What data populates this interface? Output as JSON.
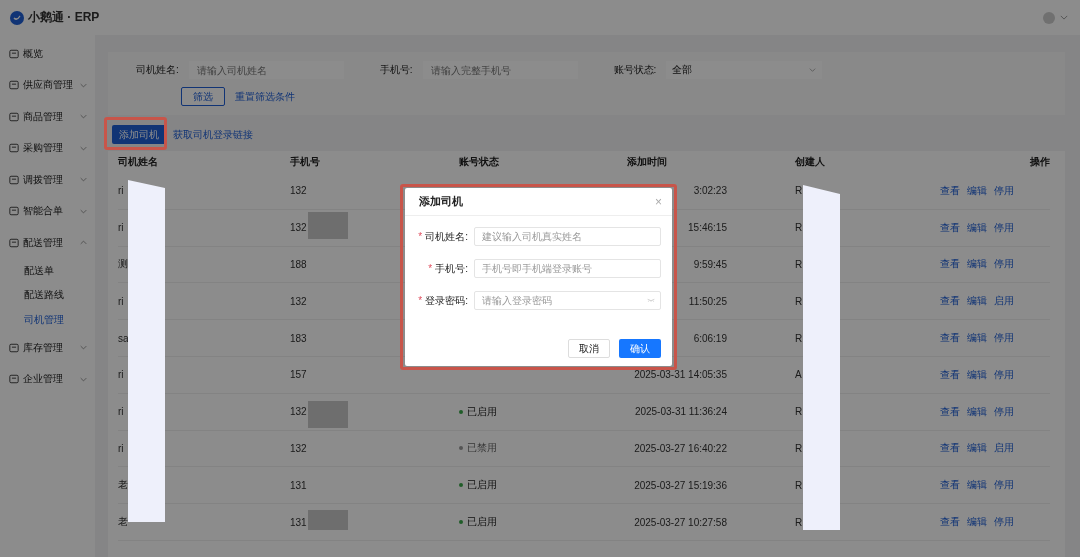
{
  "header": {
    "logo_text": "小鹅通 · ERP"
  },
  "sidebar": {
    "items": [
      {
        "label": "概览"
      },
      {
        "label": "供应商管理",
        "expanded": false
      },
      {
        "label": "商品管理",
        "expanded": false
      },
      {
        "label": "采购管理",
        "expanded": false
      },
      {
        "label": "调拨管理",
        "expanded": false
      },
      {
        "label": "智能合单",
        "expanded": false
      },
      {
        "label": "配送管理",
        "expanded": true,
        "children": [
          {
            "label": "配送单",
            "selected": false
          },
          {
            "label": "配送路线",
            "selected": false
          },
          {
            "label": "司机管理",
            "selected": true
          }
        ]
      },
      {
        "label": "库存管理",
        "expanded": false
      },
      {
        "label": "企业管理",
        "expanded": false
      }
    ]
  },
  "filters": {
    "fields": [
      {
        "kind": "input",
        "label": "司机姓名:",
        "placeholder": "请输入司机姓名"
      },
      {
        "kind": "input",
        "label": "手机号:",
        "placeholder": "请输入完整手机号"
      },
      {
        "kind": "select",
        "label": "账号状态:",
        "value": "全部"
      }
    ],
    "filter_button": "筛选",
    "reset_link": "重置筛选条件"
  },
  "toolbar": {
    "add_button": "添加司机",
    "login_link": "获取司机登录链接"
  },
  "table": {
    "columns": [
      "司机姓名",
      "手机号",
      "账号状态",
      "添加时间",
      "创建人",
      "操作"
    ],
    "rows": [
      {
        "name": "ri",
        "phone": "132",
        "time": "3:02:23",
        "creator": "R",
        "actions": [
          "查看",
          "编辑",
          "停用"
        ]
      },
      {
        "name": "ri",
        "phone": "132",
        "time": "15:46:15",
        "creator": "R",
        "actions": [
          "查看",
          "编辑",
          "停用"
        ]
      },
      {
        "name": "测",
        "phone": "188",
        "time": "9:59:45",
        "creator": "R",
        "actions": [
          "查看",
          "编辑",
          "停用"
        ]
      },
      {
        "name": "ri",
        "phone": "132",
        "time": "11:50:25",
        "creator": "R",
        "actions": [
          "查看",
          "编辑",
          "启用"
        ]
      },
      {
        "name": "sa",
        "phone": "183",
        "time": "6:06:19",
        "creator": "R",
        "actions": [
          "查看",
          "编辑",
          "停用"
        ]
      },
      {
        "name": "ri",
        "phone": "157",
        "time": "2025-03-31 14:05:35",
        "creator": "A",
        "actions": [
          "查看",
          "编辑",
          "停用"
        ]
      },
      {
        "name": "ri",
        "phone": "132",
        "status": {
          "text": "已启用",
          "enabled": true
        },
        "time": "2025-03-31 11:36:24",
        "creator": "R",
        "actions": [
          "查看",
          "编辑",
          "停用"
        ]
      },
      {
        "name": "ri",
        "phone": "132",
        "status": {
          "text": "已禁用",
          "enabled": false
        },
        "time": "2025-03-27 16:40:22",
        "creator": "R",
        "actions": [
          "查看",
          "编辑",
          "启用"
        ]
      },
      {
        "name": "老",
        "phone": "131",
        "status": {
          "text": "已启用",
          "enabled": true
        },
        "time": "2025-03-27 15:19:36",
        "creator": "R",
        "actions": [
          "查看",
          "编辑",
          "停用"
        ]
      },
      {
        "name": "老",
        "phone": "131",
        "status": {
          "text": "已启用",
          "enabled": true
        },
        "time": "2025-03-27 10:27:58",
        "creator": "R",
        "actions": [
          "查看",
          "编辑",
          "停用"
        ]
      }
    ]
  },
  "dialog": {
    "title": "添加司机",
    "close": "×",
    "required_mark": "*",
    "fields": [
      {
        "kind": "text",
        "label": "司机姓名:",
        "required": true,
        "placeholder": "建议输入司机真实姓名"
      },
      {
        "kind": "text",
        "label": "手机号:",
        "required": true,
        "placeholder": "手机号即手机端登录账号"
      },
      {
        "kind": "password",
        "label": "登录密码:",
        "required": true,
        "placeholder": "请输入登录密码"
      }
    ],
    "cancel_button": "取消",
    "confirm_button": "确认"
  }
}
